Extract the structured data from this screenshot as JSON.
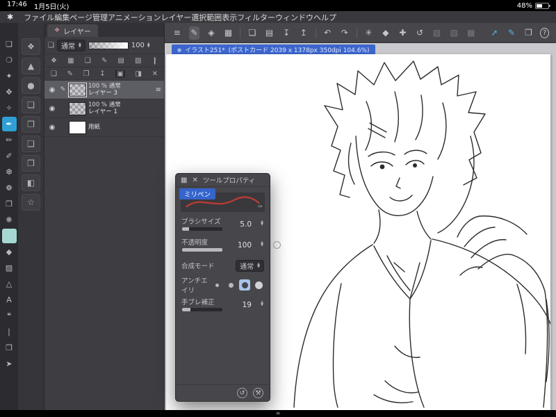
{
  "status_bar": {
    "time": "17:46",
    "date": "1月5日(火)",
    "battery": "48%"
  },
  "menu_bar": {
    "logo_glyph": "✱",
    "items": [
      "ファイル",
      "編集",
      "ページ管理",
      "アニメーション",
      "レイヤー",
      "選択範囲",
      "表示",
      "フィルター",
      "ウィンドウ",
      "ヘルプ"
    ]
  },
  "command_bar": {
    "icons": [
      {
        "name": "main-menu-icon",
        "glyph": "≡"
      },
      {
        "name": "pen-mode-icon",
        "glyph": "✎",
        "cls": "boxed"
      },
      {
        "name": "select-mode-icon",
        "glyph": "◈"
      },
      {
        "name": "workspace-grid-icon",
        "glyph": "▦"
      },
      {
        "name": "divider-1",
        "cls": "divider"
      },
      {
        "name": "new-canvas-icon",
        "glyph": "❏"
      },
      {
        "name": "open-file-icon",
        "glyph": "▤"
      },
      {
        "name": "save-icon",
        "glyph": "↧"
      },
      {
        "name": "share-icon",
        "glyph": "↥"
      },
      {
        "name": "divider-2",
        "cls": "divider"
      },
      {
        "name": "undo-icon",
        "glyph": "↶"
      },
      {
        "name": "redo-icon",
        "glyph": "↷"
      },
      {
        "name": "divider-3",
        "cls": "divider"
      },
      {
        "name": "clear-icon",
        "glyph": "✳"
      },
      {
        "name": "fill-icon",
        "glyph": "◆"
      },
      {
        "name": "snap-icon",
        "glyph": "✚"
      },
      {
        "name": "rotate-canvas-icon",
        "glyph": "↺"
      },
      {
        "name": "flip-icon",
        "glyph": "▧",
        "cls": "disabled"
      },
      {
        "name": "grid-overlay-icon",
        "glyph": "▨",
        "cls": "disabled"
      },
      {
        "name": "material-panel-icon",
        "glyph": "▩",
        "cls": "disabled"
      },
      {
        "name": "spacer",
        "cls": "push"
      },
      {
        "name": "vector-line-icon",
        "glyph": "➚",
        "cls": "blue"
      },
      {
        "name": "vector-pen-icon",
        "glyph": "✎",
        "cls": "blue"
      },
      {
        "name": "sub-view-icon",
        "glyph": "❒"
      },
      {
        "name": "help-icon",
        "glyph": "?",
        "cls": "circle"
      }
    ]
  },
  "tool_sidebar": {
    "tools": [
      {
        "name": "selection-tool-icon",
        "glyph": "❏"
      },
      {
        "name": "lasso-tool-icon",
        "glyph": "❍"
      },
      {
        "name": "auto-select-tool-icon",
        "glyph": "✦"
      },
      {
        "name": "move-tool-icon",
        "glyph": "✥"
      },
      {
        "name": "eyedropper-tool-icon",
        "glyph": "✧"
      },
      {
        "name": "pen-tool-icon",
        "glyph": "✒",
        "cls": "active"
      },
      {
        "name": "pencil-tool-icon",
        "glyph": "✏"
      },
      {
        "name": "brush-tool-icon",
        "glyph": "✐"
      },
      {
        "name": "airbrush-tool-icon",
        "glyph": "❆"
      },
      {
        "name": "decoration-tool-icon",
        "glyph": "❁"
      },
      {
        "name": "eraser-tool-icon",
        "glyph": "❒"
      },
      {
        "name": "blend-tool-icon",
        "glyph": "❋"
      },
      {
        "name": "selection-layer-swatch-icon",
        "glyph": "■",
        "cls": "teal"
      },
      {
        "name": "fill-tool-icon",
        "glyph": "◆"
      },
      {
        "name": "gradient-tool-icon",
        "glyph": "▨"
      },
      {
        "name": "figure-tool-icon",
        "glyph": "△"
      },
      {
        "name": "text-tool-icon",
        "glyph": "A"
      },
      {
        "name": "balloon-tool-icon",
        "glyph": "❝"
      },
      {
        "name": "ruler-tool-icon",
        "glyph": "❘"
      },
      {
        "name": "frame-border-tool-icon",
        "glyph": "❐"
      },
      {
        "name": "operation-tool-icon",
        "glyph": "➤"
      }
    ]
  },
  "subtool_strip": {
    "groups": [
      {
        "name": "subtool-marker-group",
        "glyph": "❖"
      },
      {
        "name": "subtool-shape-group",
        "glyph": "▲"
      },
      {
        "name": "subtool-round-group",
        "glyph": "●"
      },
      {
        "name": "subtool-deck-1",
        "glyph": "❏"
      },
      {
        "name": "subtool-deck-2",
        "glyph": "❐"
      },
      {
        "name": "subtool-deck-3",
        "glyph": "❑"
      },
      {
        "name": "subtool-deck-4",
        "glyph": "❒"
      },
      {
        "name": "subtool-layers",
        "glyph": "◧"
      },
      {
        "name": "subtool-favorites",
        "glyph": "☆"
      }
    ]
  },
  "layer_panel": {
    "tab_label": "レイヤー",
    "palette_icon": "❖",
    "combine_icon": "❏",
    "blend_mode": "通常",
    "opacity_value": "100",
    "effect_icons": [
      {
        "name": "blend-through-icon",
        "glyph": "❖"
      },
      {
        "name": "preserve-opacity-icon",
        "glyph": "▦"
      },
      {
        "name": "clip-to-layer-icon",
        "glyph": "❏"
      },
      {
        "name": "draft-layer-icon",
        "glyph": "✎"
      },
      {
        "name": "ruler-range-icon",
        "glyph": "▤"
      },
      {
        "name": "reference-layer-icon",
        "glyph": "▧"
      },
      {
        "name": "lock-layer-icon",
        "glyph": "❙"
      }
    ],
    "action_icons": [
      {
        "name": "new-raster-layer-icon",
        "glyph": "❏"
      },
      {
        "name": "new-vector-layer-icon",
        "glyph": "✎"
      },
      {
        "name": "new-folder-icon",
        "glyph": "❐"
      },
      {
        "name": "transfer-down-icon",
        "glyph": "↧"
      },
      {
        "name": "merge-down-icon",
        "glyph": "▣",
        "cls": "pressed"
      },
      {
        "name": "layer-mask-icon",
        "glyph": "◨"
      },
      {
        "name": "delete-layer-icon",
        "glyph": "✕"
      }
    ],
    "layers": [
      {
        "meta": "100 %  通常",
        "name": "レイヤー 3"
      },
      {
        "meta": "100 %  通常",
        "name": "レイヤー 1"
      },
      {
        "name": "用紙"
      }
    ]
  },
  "canvas": {
    "indicator": "●",
    "title": "イラスト251*",
    "info": "(ポストカード 2039 x 1378px 350dpi 104.6%)"
  },
  "tool_property": {
    "grid_icon": "▦",
    "close_icon": "✕",
    "title": "ツールプロパティ",
    "tool_name": "ミリペン",
    "pen_icon": "✑",
    "rows": {
      "brush_size": {
        "label": "ブラシサイズ",
        "value": "5.0"
      },
      "opacity": {
        "label": "不透明度",
        "value": "100"
      },
      "blend_mode": {
        "label": "合成モード",
        "value": "通常"
      },
      "anti_aliasing": {
        "label": "アンチエイリ",
        "options": [
          "none",
          "weak",
          "middle",
          "strong"
        ],
        "selected": "middle"
      },
      "stabilization": {
        "label": "手ブレ補正",
        "value": "19"
      }
    },
    "footer_icons": [
      {
        "name": "reset-defaults-icon",
        "glyph": "↺"
      },
      {
        "name": "tool-settings-icon",
        "glyph": "⚒"
      }
    ]
  },
  "icons": {
    "eye": "◉",
    "edit": "✎",
    "menu": "≡",
    "up": "▲",
    "down": "▼",
    "handle": "≡"
  }
}
